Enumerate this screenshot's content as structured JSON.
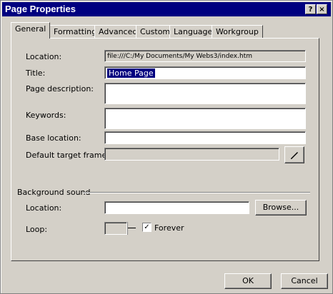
{
  "window": {
    "title": "Page Properties",
    "help_glyph": "?",
    "close_glyph": "×"
  },
  "tabs": [
    "General",
    "Formatting",
    "Advanced",
    "Custom",
    "Language",
    "Workgroup"
  ],
  "general": {
    "location_label": "Location:",
    "location_value": "file:///C:/My Documents/My Webs3/index.htm",
    "title_label": "Title:",
    "title_value": "Home Page",
    "description_label": "Page description:",
    "keywords_label": "Keywords:",
    "base_location_label": "Base location:",
    "default_target_label": "Default target frame:"
  },
  "background_sound": {
    "group_label": "Background sound",
    "location_label": "Location:",
    "browse_label": "Browse...",
    "loop_label": "Loop:",
    "loop_value": "",
    "forever_label": "Forever",
    "forever_checked": "✓"
  },
  "buttons": {
    "ok": "OK",
    "cancel": "Cancel"
  }
}
